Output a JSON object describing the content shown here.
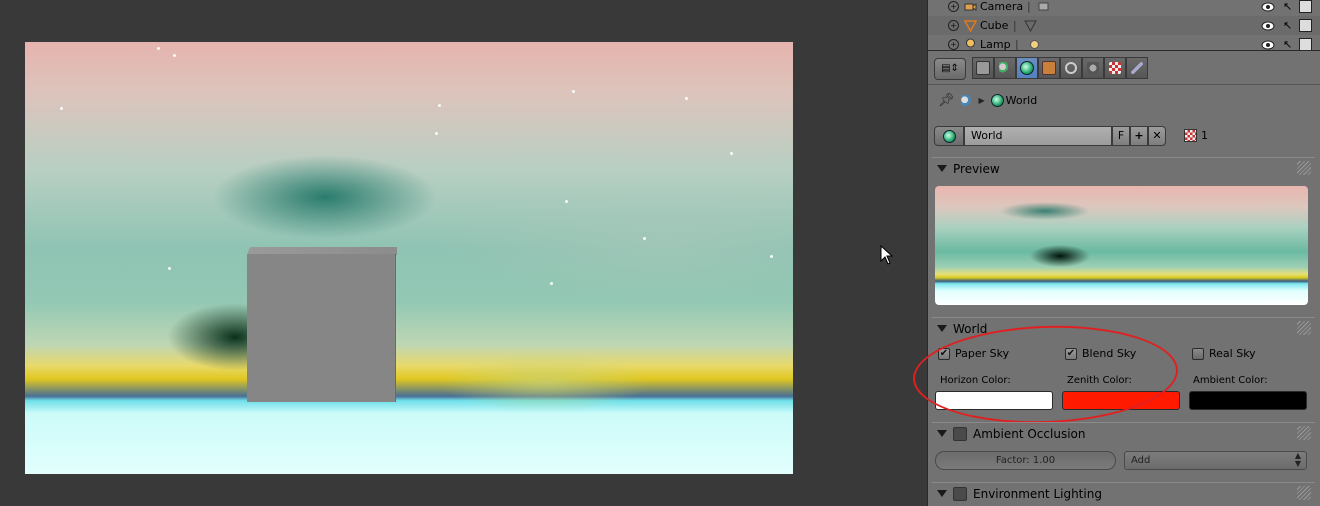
{
  "outliner": {
    "rows": [
      {
        "label": "Camera",
        "icon": "camera-icon"
      },
      {
        "label": "Cube",
        "icon": "mesh-icon"
      },
      {
        "label": "Lamp",
        "icon": "lamp-icon"
      }
    ],
    "separator": "|"
  },
  "properties": {
    "editor_type_label": "▤⇕",
    "tabs": [
      {
        "name": "render-tab",
        "icon": "camera-icon",
        "active": false
      },
      {
        "name": "scene-tab",
        "icon": "scene-icon",
        "active": false
      },
      {
        "name": "world-tab",
        "icon": "world-icon",
        "active": true
      },
      {
        "name": "object-tab",
        "icon": "object-icon",
        "active": false
      },
      {
        "name": "constraints-tab",
        "icon": "constraint-icon",
        "active": false
      },
      {
        "name": "modifiers-tab",
        "icon": "modifier-icon",
        "active": false
      },
      {
        "name": "texture-tab",
        "icon": "texture-icon",
        "active": false
      },
      {
        "name": "physics-tab",
        "icon": "physics-icon",
        "active": false
      }
    ],
    "breadcrumb": {
      "label": "World"
    },
    "datablock": {
      "name": "World",
      "fake_user": "F",
      "add": "+",
      "remove": "✕",
      "users": "1"
    },
    "panels": {
      "preview": "Preview",
      "world": "World",
      "ambient_occlusion": "Ambient Occlusion",
      "environment_lighting": "Environment Lighting"
    },
    "world": {
      "paper_sky": {
        "label": "Paper Sky",
        "checked": true
      },
      "blend_sky": {
        "label": "Blend Sky",
        "checked": true
      },
      "real_sky": {
        "label": "Real Sky",
        "checked": false
      },
      "horizon_label": "Horizon Color:",
      "zenith_label": "Zenith Color:",
      "ambient_label": "Ambient Color:",
      "horizon_color": "#ffffff",
      "zenith_color": "#ff1a00",
      "ambient_color": "#000000"
    },
    "ao": {
      "factor": "Factor: 1.00",
      "blend_mode": "Add"
    }
  },
  "colors": {
    "accent": "#5680c2",
    "annotation": "#e02020"
  }
}
